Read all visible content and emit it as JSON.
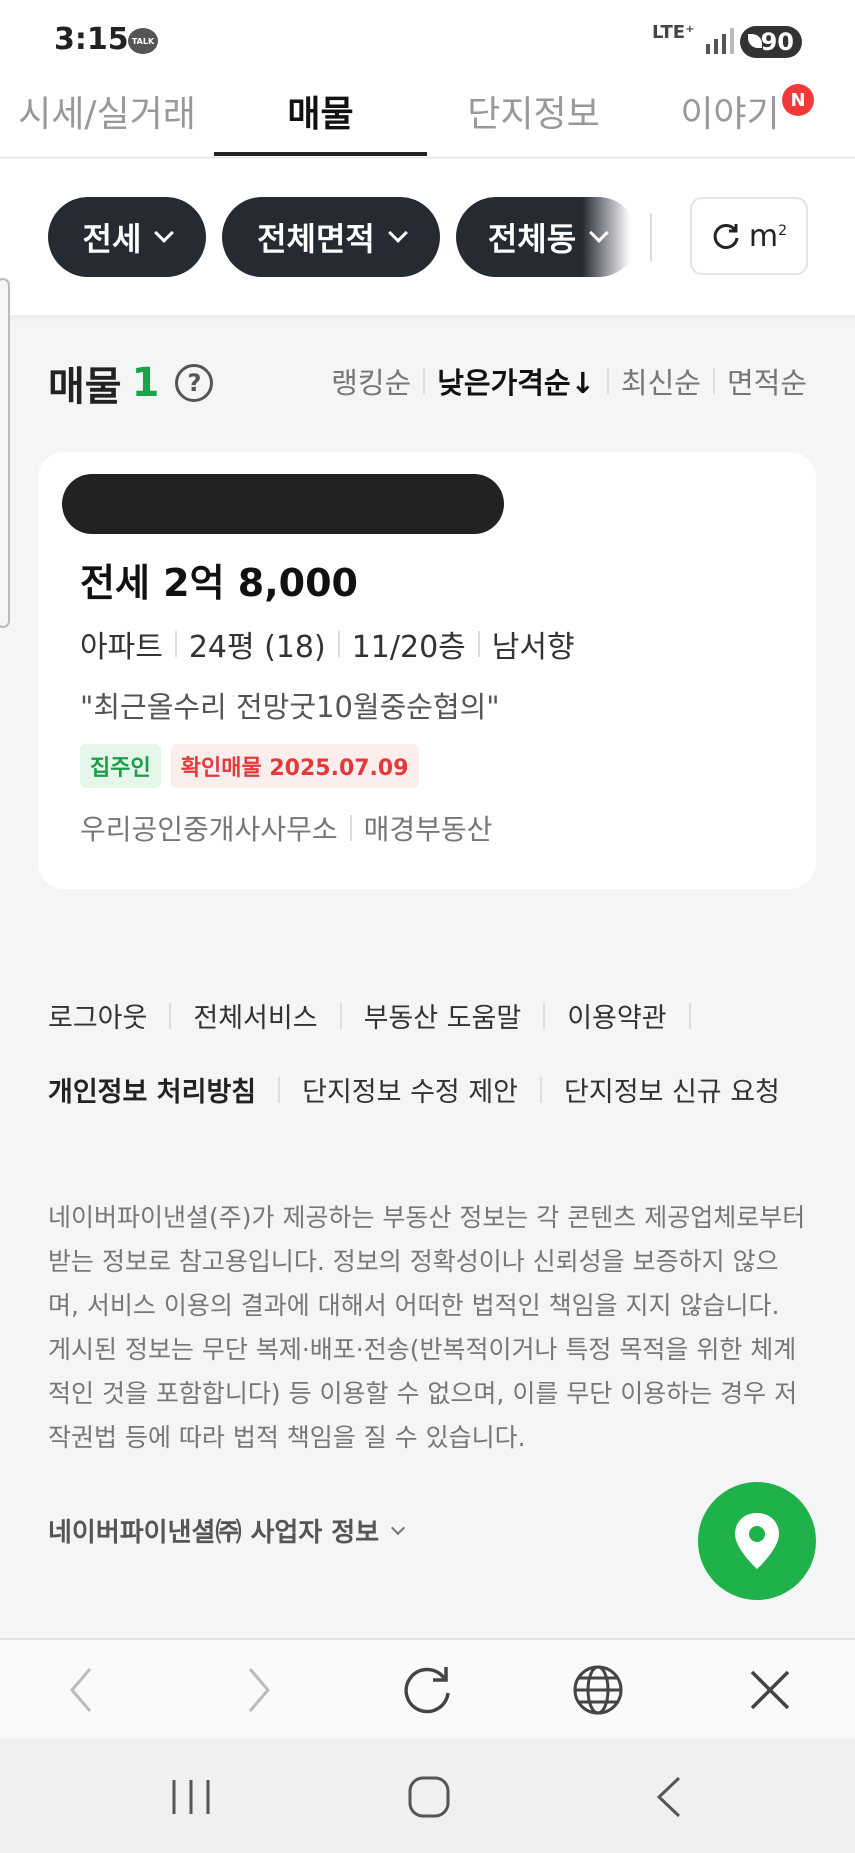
{
  "status_bar": {
    "time": "3:15",
    "talk_icon_label": "TALK",
    "network": "LTE⁺",
    "battery": "90"
  },
  "tabs": [
    {
      "label": "시세/실거래",
      "active": false
    },
    {
      "label": "매물",
      "active": true
    },
    {
      "label": "단지정보",
      "active": false
    },
    {
      "label": "이야기",
      "active": false,
      "badge": "N"
    }
  ],
  "filters": {
    "chips": [
      "전세",
      "전체면적",
      "전체동"
    ],
    "unit_button": {
      "label": "m",
      "superscript": "2"
    }
  },
  "listing_header": {
    "title": "매물",
    "count": "1",
    "help": "?",
    "sorts": [
      {
        "label": "랭킹순",
        "active": false
      },
      {
        "label": "낮은가격순↓",
        "active": true
      },
      {
        "label": "최신순",
        "active": false
      },
      {
        "label": "면적순",
        "active": false
      }
    ]
  },
  "listing": {
    "price": "전세 2억 8,000",
    "type": "아파트",
    "size": "24평 (18)",
    "floor": "11/20층",
    "direction": "남서향",
    "description": "\"최근올수리 전망굿10월중순협의\"",
    "tag_owner": "집주인",
    "tag_verified": "확인매물 2025.07.09",
    "agent": "우리공인중개사사무소",
    "provider": "매경부동산"
  },
  "footer": {
    "links_row1": [
      "로그아웃",
      "전체서비스",
      "부동산 도움말",
      "이용약관"
    ],
    "links_row2": [
      "개인정보 처리방침",
      "단지정보 수정 제안",
      "단지정보 신규 요청"
    ],
    "disclaimer": "네이버파이낸셜(주)가 제공하는 부동산 정보는 각 콘텐츠 제공업체로부터 받는 정보로 참고용입니다. 정보의 정확성이나 신뢰성을 보증하지 않으며, 서비스 이용의 결과에 대해서 어떠한 법적인 책임을 지지 않습니다. 게시된 정보는 무단 복제·배포·전송(반복적이거나 특정 목적을 위한 체계적인 것을 포함합니다) 등 이용할 수 없으며, 이를 무단 이용하는 경우 저작권법 등에 따라 법적 책임을 질 수 있습니다.",
    "business_info": "네이버파이낸셜㈜ 사업자 정보"
  },
  "colors": {
    "accent_green": "#1fb14a",
    "chip_dark": "#252a33",
    "badge_red": "#f23a3a"
  },
  "icons": [
    "map-pin-icon",
    "back-arrow-icon",
    "forward-arrow-icon",
    "refresh-icon",
    "globe-icon",
    "close-icon"
  ]
}
